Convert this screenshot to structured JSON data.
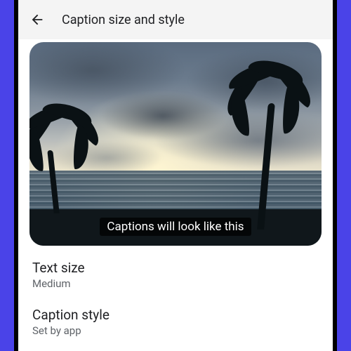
{
  "appbar": {
    "title": "Caption size and style"
  },
  "preview": {
    "caption_text": "Captions will look like this"
  },
  "settings": {
    "text_size": {
      "title": "Text size",
      "value": "Medium"
    },
    "caption_style": {
      "title": "Caption style",
      "value": "Set by app"
    }
  }
}
